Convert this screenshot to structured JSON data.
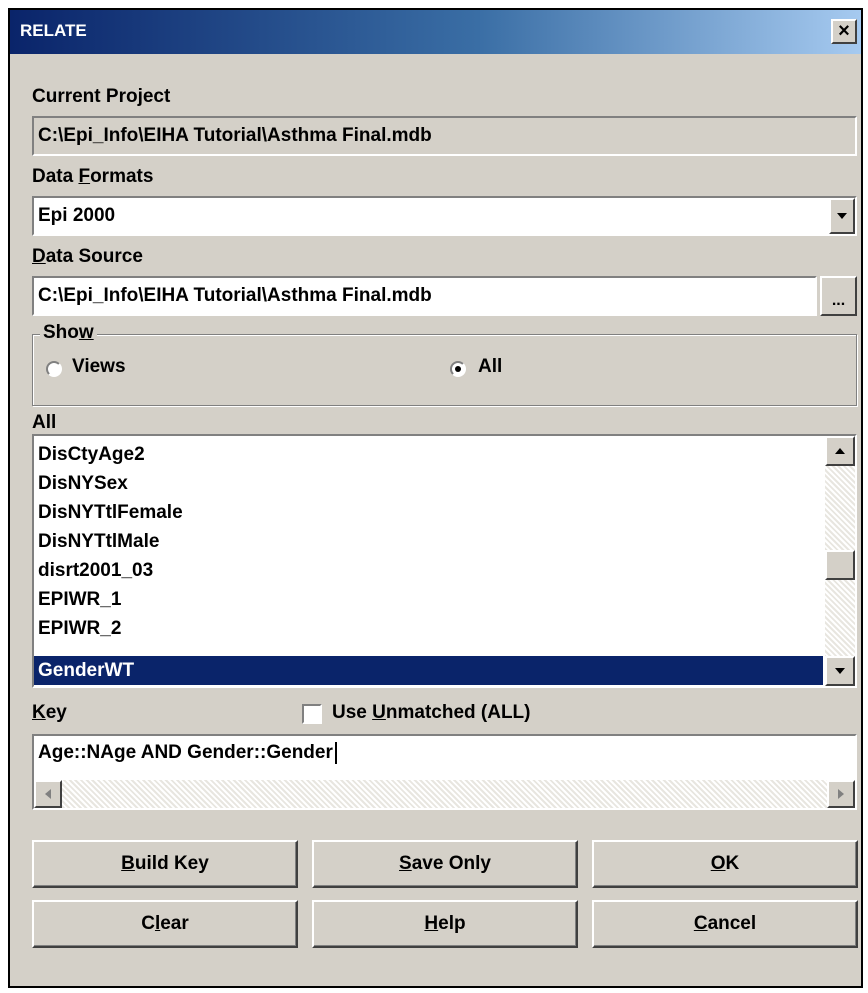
{
  "window": {
    "title": "RELATE",
    "close_glyph": "×"
  },
  "current_project": {
    "label": "Current Project",
    "value": "C:\\Epi_Info\\EIHA Tutorial\\Asthma Final.mdb"
  },
  "data_formats": {
    "label_pre": "Data ",
    "label_accel": "F",
    "label_post": "ormats",
    "selected": "Epi 2000"
  },
  "data_source": {
    "label_accel": "D",
    "label_post": "ata Source",
    "value": "C:\\Epi_Info\\EIHA Tutorial\\Asthma Final.mdb",
    "browse_label": "..."
  },
  "show": {
    "legend_pre": "Sho",
    "legend_accel": "w",
    "options": [
      {
        "label": "Views",
        "selected": false
      },
      {
        "label": "All",
        "selected": true
      }
    ]
  },
  "list": {
    "label": "All",
    "items": [
      "DisCtyAge2",
      "DisNYSex",
      "DisNYTtlFemale",
      "DisNYTtlMale",
      "disrt2001_03",
      "EPIWR_1",
      "EPIWR_2",
      "GenderWT"
    ],
    "selected": "GenderWT"
  },
  "key": {
    "label_accel": "K",
    "label_post": "ey",
    "value": "Age::NAge AND Gender::Gender"
  },
  "use_unmatched": {
    "label_pre": "Use ",
    "label_accel": "U",
    "label_post": "nmatched (ALL)",
    "checked": false
  },
  "buttons": {
    "build_key": {
      "accel": "B",
      "rest": "uild Key"
    },
    "save_only": {
      "accel": "S",
      "rest": "ave Only"
    },
    "ok": {
      "accel": "O",
      "rest": "K"
    },
    "clear": {
      "pre": "C",
      "accel": "l",
      "rest": "ear"
    },
    "help": {
      "accel": "H",
      "rest": "elp"
    },
    "cancel": {
      "accel": "C",
      "rest": "ancel"
    }
  },
  "colors": {
    "title_gradient_start": "#0a246a",
    "title_gradient_end": "#a6caf0",
    "dialog_face": "#d4d0c8",
    "selection": "#0a246a"
  }
}
